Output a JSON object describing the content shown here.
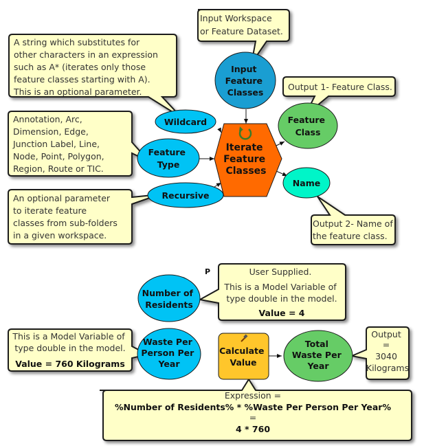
{
  "colors": {
    "input_variable": "#00c3f5",
    "input_dataset": "#1a9ed2",
    "tool_iterator": "#ff6a00",
    "tool_calculate": "#ffc62b",
    "output_feature_class": "#66cc66",
    "output_name": "#00f5c8",
    "callout_fill": "#ffffc8",
    "stroke": "#1a1a1a"
  },
  "top_model": {
    "nodes": {
      "input_feature_classes": [
        "Input",
        "Feature",
        "Classes"
      ],
      "wildcard": [
        "Wildcard"
      ],
      "feature_type": [
        "Feature",
        "Type"
      ],
      "recursive": [
        "Recursive"
      ],
      "iterate_feature_classes": [
        "Iterate",
        "Feature",
        "Classes"
      ],
      "feature_class": [
        "Feature",
        "Class"
      ],
      "name": [
        "Name"
      ]
    },
    "callouts": {
      "input_workspace": [
        "Input Workspace",
        "or Feature Dataset."
      ],
      "wildcard": [
        "A string which substitutes for",
        "other characters in an expression",
        "such as A* (iterates only those",
        "feature classes starting with A).",
        "This is an optional parameter."
      ],
      "feature_type": [
        "Annotation, Arc,",
        "Dimension, Edge,",
        "Junction Label, Line,",
        "Node, Point, Polygon,",
        "Region, Route or TIC."
      ],
      "recursive": [
        "An optional parameter",
        "to iterate feature",
        "classes from sub-folders",
        "in a given workspace."
      ],
      "output1": [
        "Output 1- Feature Class."
      ],
      "output2": [
        "Output 2- Name of",
        "the feature class."
      ]
    },
    "iterator_icon": "iterate-icon"
  },
  "bottom_model": {
    "parameter_marker": "P",
    "nodes": {
      "number_of_residents": [
        "Number of",
        "Residents"
      ],
      "waste_per_person": [
        "Waste Per",
        "Person Per",
        "Year"
      ],
      "calculate_value": [
        "Calculate",
        "Value"
      ],
      "total_waste": [
        "Total",
        "Waste Per",
        "Year"
      ]
    },
    "callouts": {
      "residents": {
        "title": "User Supplied.",
        "lines": [
          "This is a Model Variable of",
          "type double in the model."
        ],
        "value": "Value = 4"
      },
      "waste": {
        "lines": [
          "This is a Model Variable of",
          "type double in the model."
        ],
        "value": "Value = 760 Kilograms"
      },
      "output": [
        "Output",
        "=",
        "3040",
        "Kilograms"
      ],
      "expression": {
        "label": "Expression =",
        "formula": "%Number of Residents% * %Waste Per Person Per Year%",
        "equals": "=",
        "evaluated": "4 * 760"
      }
    },
    "tool_icon": "hammer-icon"
  }
}
